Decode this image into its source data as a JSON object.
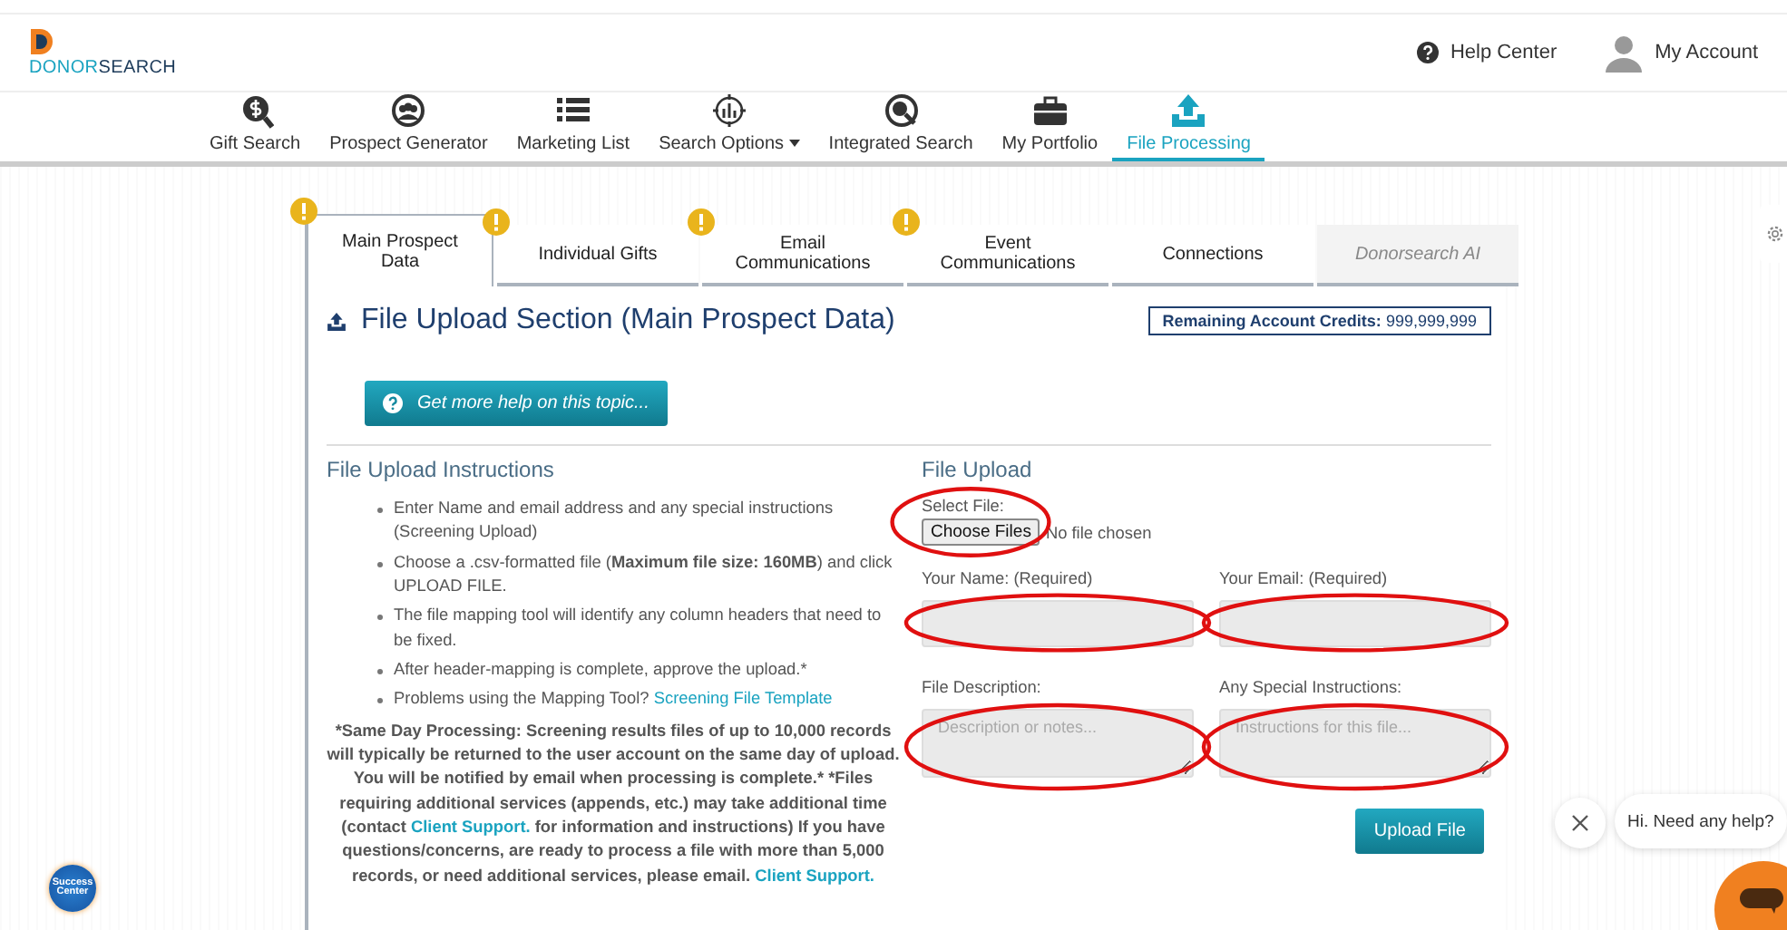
{
  "header": {
    "logo": {
      "parts": [
        "DONOR",
        "SEARCH"
      ]
    },
    "help": "Help Center",
    "account": "My Account"
  },
  "nav": [
    {
      "label": "Gift Search",
      "kind": "gift",
      "selected": false,
      "dropdown": false
    },
    {
      "label": "Prospect Generator",
      "kind": "prospect",
      "selected": false,
      "dropdown": false
    },
    {
      "label": "Marketing List",
      "kind": "list",
      "selected": false,
      "dropdown": false
    },
    {
      "label": "Search Options",
      "kind": "options",
      "selected": false,
      "dropdown": true
    },
    {
      "label": "Integrated Search",
      "kind": "integrated",
      "selected": false,
      "dropdown": false
    },
    {
      "label": "My Portfolio",
      "kind": "portfolio",
      "selected": false,
      "dropdown": false
    },
    {
      "label": "File Processing",
      "kind": "upload",
      "selected": true,
      "dropdown": false
    }
  ],
  "tabs": [
    {
      "label": "Main Prospect Data",
      "selected": true,
      "warning": true,
      "disabled": false
    },
    {
      "label": "Individual Gifts",
      "selected": false,
      "warning": true,
      "disabled": false
    },
    {
      "label": "Email Communications",
      "selected": false,
      "warning": true,
      "disabled": false
    },
    {
      "label": "Event Communications",
      "selected": false,
      "warning": true,
      "disabled": false
    },
    {
      "label": "Connections",
      "selected": false,
      "warning": false,
      "disabled": false
    },
    {
      "label": "Donorsearch AI",
      "selected": false,
      "warning": false,
      "disabled": true
    }
  ],
  "section": {
    "title": "File Upload Section (Main Prospect Data)",
    "credits": "**Remaining Account Credits:** 999,999,999",
    "help_button": "Get more help on this topic..."
  },
  "instructions": {
    "heading": "File Upload Instructions",
    "items": [
      "Enter Name and email address and any special instructions (Screening Upload)",
      "Choose a .csv-formatted file (**Maximum file size: 160MB**) and click UPLOAD FILE.",
      "The file mapping tool will identify any column headers that need to be fixed.",
      "After header-mapping is complete, approve the upload.*",
      "Problems using the Mapping Tool?"
    ],
    "template_link": "Screening File Template",
    "note": [
      "*Same Day Processing: Screening results files of up to 10,000 records will typically be returned to the user account on the same day of upload. You will be notified by email when processing is complete.* *Files requiring additional services (appends, etc.) may take additional time (contact ",
      "Client Support.",
      " for information and instructions) If you have questions/concerns, are ready to process a file with more than 5,000 records, or need additional services, please email. ",
      "Client Support."
    ]
  },
  "upload": {
    "heading": "File Upload",
    "select_label": "Select File:",
    "choose_button": "Choose Files",
    "no_file": "No file chosen",
    "select_circled": true,
    "fields": [
      {
        "kind": "input",
        "label": "Your Name: (Required)",
        "circled": true
      },
      {
        "kind": "input",
        "label": "Your Email: (Required)",
        "circled": true
      },
      {
        "kind": "textarea",
        "label": "File Description:",
        "placeholder": "Description or notes...",
        "circled": true
      },
      {
        "kind": "textarea",
        "label": "Any Special Instructions:",
        "placeholder": "Instructions for this file...",
        "circled": true
      }
    ],
    "submit": "Upload File"
  },
  "success_center": "Success Center",
  "chat": {
    "message": "Hi. Need any help?"
  }
}
